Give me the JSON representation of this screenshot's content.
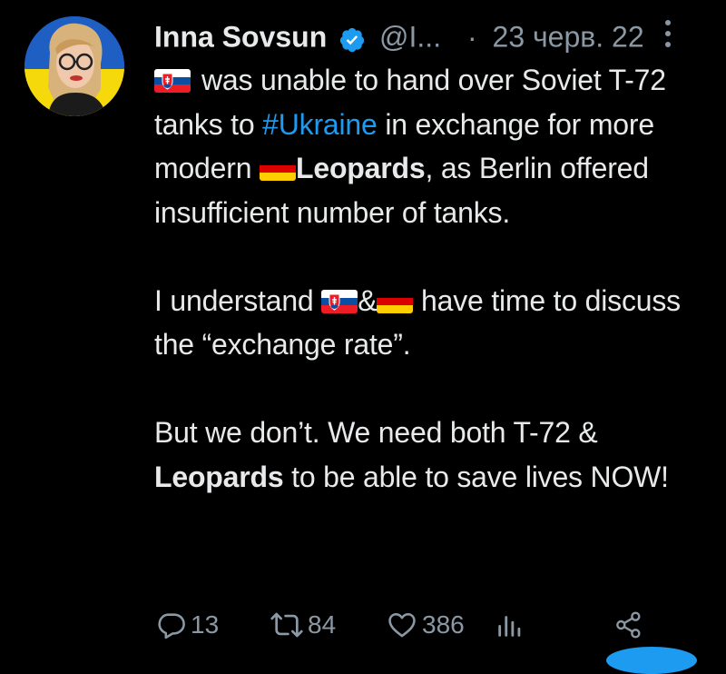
{
  "colors": {
    "background": "#000000",
    "text": "#e7e9ea",
    "secondary": "#8b98a5",
    "accent": "#1d9bf0"
  },
  "author": {
    "name": "Inna Sovsun",
    "handle": "@I...",
    "verified_icon": "verified-badge-icon"
  },
  "meta": {
    "separator": "·",
    "date": "23 черв. 22",
    "more_icon": "more-vertical-icon"
  },
  "tweet": {
    "p1": {
      "flag1": "slovakia-flag-icon",
      "t1": "was unable to hand over Soviet T-72 tanks to ",
      "hashtag": "#Ukraine",
      "t2": " in exchange for more modern ",
      "flag2": "germany-flag-icon",
      "bold": "Leopards",
      "t3": ", as Berlin offered insufficient number of tanks."
    },
    "p2": {
      "t1": "I understand ",
      "flag1": "slovakia-flag-icon",
      "amp": "&",
      "flag2": "germany-flag-icon",
      "t2": " have time to discuss the “exchange rate”."
    },
    "p3": {
      "t1": "But we don’t. We need both T-72 & ",
      "bold": "Leopards",
      "t2": " to be able to save lives NOW!"
    }
  },
  "actions": {
    "reply": {
      "icon": "reply-icon",
      "count": "13"
    },
    "retweet": {
      "icon": "retweet-icon",
      "count": "84"
    },
    "like": {
      "icon": "heart-icon",
      "count": "386"
    },
    "views": {
      "icon": "views-icon"
    },
    "share": {
      "icon": "share-icon"
    }
  }
}
